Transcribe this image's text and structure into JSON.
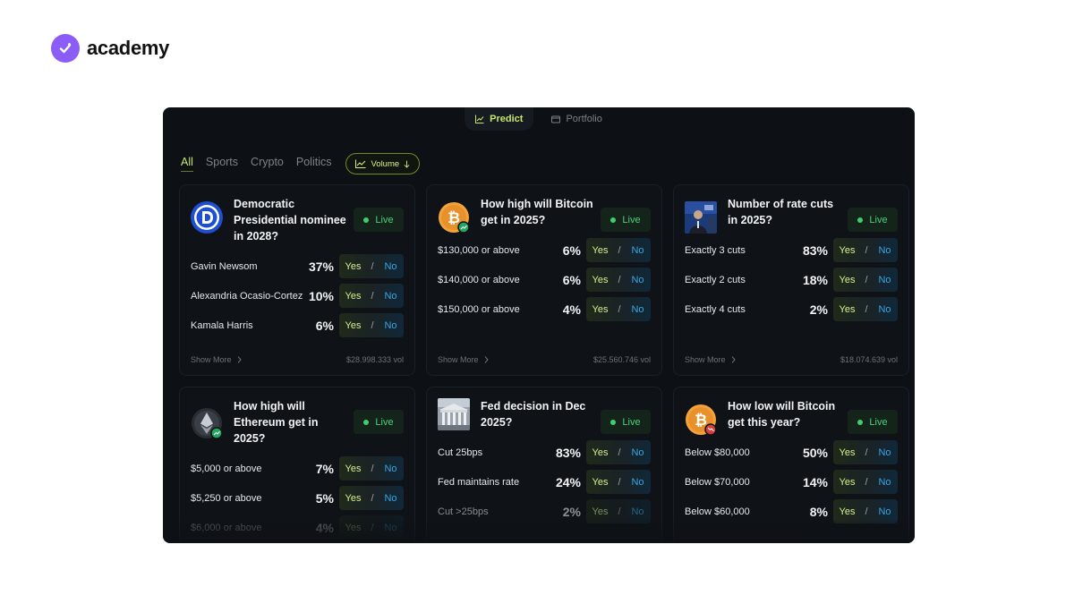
{
  "brand": {
    "name": "academy",
    "logo_icon": "check-badge-icon",
    "logo_color": "#8b5cf6"
  },
  "topnav": [
    {
      "label": "Predict",
      "icon": "chart-line-icon",
      "active": true
    },
    {
      "label": "Portfolio",
      "icon": "wallet-icon",
      "active": false
    }
  ],
  "filters": {
    "tabs": [
      {
        "label": "All",
        "active": true
      },
      {
        "label": "Sports",
        "active": false
      },
      {
        "label": "Crypto",
        "active": false
      },
      {
        "label": "Politics",
        "active": false
      }
    ],
    "sort": {
      "label": "Volume",
      "icon": "chart-line-icon",
      "direction_icon": "arrow-down-icon"
    }
  },
  "colors": {
    "accent": "#c6e66b",
    "live": "#3fcf71",
    "no": "#38a6e6",
    "background": "#0d1014"
  },
  "cards": [
    {
      "title": "Democratic Presidential nominee in 2028?",
      "icon": "democrat-logo-icon",
      "status": "Live",
      "outcomes": [
        {
          "label": "Gavin Newsom",
          "pct": "37%",
          "yes": "Yes",
          "no": "No"
        },
        {
          "label": "Alexandria Ocasio-Cortez",
          "pct": "10%",
          "yes": "Yes",
          "no": "No"
        },
        {
          "label": "Kamala Harris",
          "pct": "6%",
          "yes": "Yes",
          "no": "No"
        }
      ],
      "show_more": "Show More",
      "volume": "$28.998.333 vol"
    },
    {
      "title": "How high will Bitcoin get in 2025?",
      "icon": "bitcoin-up-icon",
      "status": "Live",
      "outcomes": [
        {
          "label": "$130,000 or above",
          "pct": "6%",
          "yes": "Yes",
          "no": "No"
        },
        {
          "label": "$140,000 or above",
          "pct": "6%",
          "yes": "Yes",
          "no": "No"
        },
        {
          "label": "$150,000 or above",
          "pct": "4%",
          "yes": "Yes",
          "no": "No"
        }
      ],
      "show_more": "Show More",
      "volume": "$25.560.746 vol"
    },
    {
      "title": "Number of rate cuts in 2025?",
      "icon": "fed-chair-photo-icon",
      "status": "Live",
      "outcomes": [
        {
          "label": "Exactly 3 cuts",
          "pct": "83%",
          "yes": "Yes",
          "no": "No"
        },
        {
          "label": "Exactly 2 cuts",
          "pct": "18%",
          "yes": "Yes",
          "no": "No"
        },
        {
          "label": "Exactly 4 cuts",
          "pct": "2%",
          "yes": "Yes",
          "no": "No"
        }
      ],
      "show_more": "Show More",
      "volume": "$18.074.639 vol"
    },
    {
      "title": "How high will Ethereum get in 2025?",
      "icon": "ethereum-up-icon",
      "status": "Live",
      "outcomes": [
        {
          "label": "$5,000 or above",
          "pct": "7%",
          "yes": "Yes",
          "no": "No"
        },
        {
          "label": "$5,250 or above",
          "pct": "5%",
          "yes": "Yes",
          "no": "No"
        },
        {
          "label": "$6,000 or above",
          "pct": "4%",
          "yes": "Yes",
          "no": "No"
        }
      ]
    },
    {
      "title": "Fed decision in Dec 2025?",
      "icon": "federal-reserve-building-icon",
      "status": "Live",
      "outcomes": [
        {
          "label": "Cut 25bps",
          "pct": "83%",
          "yes": "Yes",
          "no": "No"
        },
        {
          "label": "Fed maintains rate",
          "pct": "24%",
          "yes": "Yes",
          "no": "No"
        },
        {
          "label": "Cut >25bps",
          "pct": "2%",
          "yes": "Yes",
          "no": "No"
        }
      ]
    },
    {
      "title": "How low will Bitcoin get this year?",
      "icon": "bitcoin-down-icon",
      "status": "Live",
      "outcomes": [
        {
          "label": "Below $80,000",
          "pct": "50%",
          "yes": "Yes",
          "no": "No"
        },
        {
          "label": "Below $70,000",
          "pct": "14%",
          "yes": "Yes",
          "no": "No"
        },
        {
          "label": "Below $60,000",
          "pct": "8%",
          "yes": "Yes",
          "no": "No"
        }
      ]
    }
  ]
}
